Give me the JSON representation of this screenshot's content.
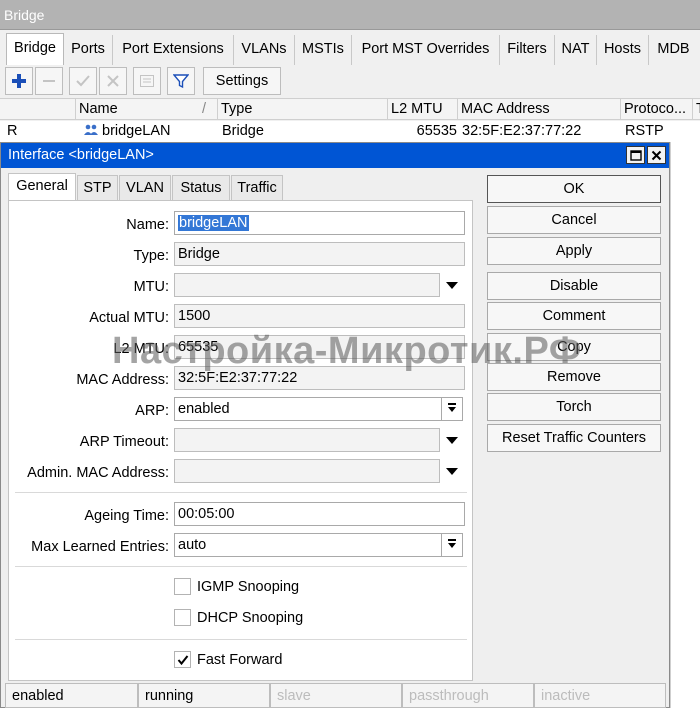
{
  "window": {
    "title": "Bridge"
  },
  "outer_tabs": [
    "Bridge",
    "Ports",
    "Port Extensions",
    "VLANs",
    "MSTIs",
    "Port MST Overrides",
    "Filters",
    "NAT",
    "Hosts",
    "MDB"
  ],
  "toolbar": {
    "settings_label": "Settings"
  },
  "table": {
    "columns": [
      "Name",
      "Type",
      "L2 MTU",
      "MAC Address",
      "Protoco...",
      "T"
    ],
    "sort_marker": "/",
    "row": {
      "flag": "R",
      "name": "bridgeLAN",
      "type": "Bridge",
      "l2mtu": "65535",
      "mac": "32:5F:E2:37:77:22",
      "protocol": "RSTP"
    }
  },
  "dialog": {
    "title": "Interface <bridgeLAN>",
    "tabs": [
      "General",
      "STP",
      "VLAN",
      "Status",
      "Traffic"
    ],
    "fields": {
      "name_label": "Name:",
      "name_value": "bridgeLAN",
      "type_label": "Type:",
      "type_value": "Bridge",
      "mtu_label": "MTU:",
      "mtu_value": "",
      "actual_mtu_label": "Actual MTU:",
      "actual_mtu_value": "1500",
      "l2mtu_label": "L2 MTU:",
      "l2mtu_value": "65535",
      "mac_label": "MAC Address:",
      "mac_value": "32:5F:E2:37:77:22",
      "arp_label": "ARP:",
      "arp_value": "enabled",
      "arp_timeout_label": "ARP Timeout:",
      "arp_timeout_value": "",
      "admin_mac_label": "Admin. MAC Address:",
      "admin_mac_value": "",
      "ageing_label": "Ageing Time:",
      "ageing_value": "00:05:00",
      "max_learned_label": "Max Learned Entries:",
      "max_learned_value": "auto"
    },
    "checkboxes": {
      "igmp_label": "IGMP Snooping",
      "igmp_checked": false,
      "dhcp_label": "DHCP Snooping",
      "dhcp_checked": false,
      "fast_forward_label": "Fast Forward",
      "fast_forward_checked": true
    },
    "buttons": [
      "OK",
      "Cancel",
      "Apply",
      "Disable",
      "Comment",
      "Copy",
      "Remove",
      "Torch",
      "Reset Traffic Counters"
    ],
    "status": [
      "enabled",
      "running",
      "slave",
      "passthrough",
      "inactive"
    ]
  },
  "watermark": "Настройка-Микротик.РФ",
  "colors": {
    "title_bar": "#0055d4",
    "selection": "#3377d6",
    "add_icon": "#1b4fb8"
  }
}
